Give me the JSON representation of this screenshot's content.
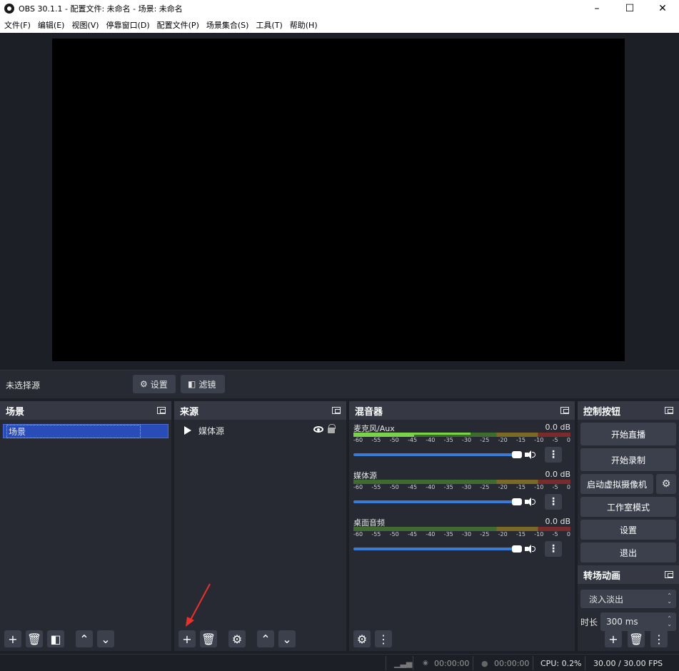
{
  "window": {
    "title": "OBS 30.1.1 - 配置文件: 未命名 - 场景: 未命名",
    "minimize": "–",
    "maximize": "☐",
    "close": "✕"
  },
  "menu": [
    "文件(F)",
    "编辑(E)",
    "视图(V)",
    "停靠窗口(D)",
    "配置文件(P)",
    "场景集合(S)",
    "工具(T)",
    "帮助(H)"
  ],
  "source_bar": {
    "label": "未选择源",
    "settings": "设置",
    "filters": "滤镜"
  },
  "scenes": {
    "title": "场景",
    "items": [
      "场景"
    ]
  },
  "sources": {
    "title": "来源",
    "items": [
      {
        "name": "媒体源"
      }
    ]
  },
  "mixer": {
    "title": "混音器",
    "scale": [
      "-60",
      "-55",
      "-50",
      "-45",
      "-40",
      "-35",
      "-30",
      "-25",
      "-20",
      "-15",
      "-10",
      "-5",
      "0"
    ],
    "channels": [
      {
        "name": "麦克风/Aux",
        "level": "0.0 dB",
        "volume": 1.0
      },
      {
        "name": "媒体源",
        "level": "0.0 dB",
        "volume": 1.0
      },
      {
        "name": "桌面音频",
        "level": "0.0 dB",
        "volume": 1.0
      }
    ]
  },
  "controls": {
    "title": "控制按钮",
    "start_stream": "开始直播",
    "start_record": "开始录制",
    "virtual_cam": "启动虚拟摄像机",
    "studio_mode": "工作室模式",
    "settings": "设置",
    "exit": "退出"
  },
  "transitions": {
    "title": "转场动画",
    "selected": "淡入淡出",
    "duration_label": "时长",
    "duration": "300 ms"
  },
  "status": {
    "stream_time": "00:00:00",
    "record_time": "00:00:00",
    "cpu": "CPU: 0.2%",
    "fps": "30.00 / 30.00 FPS"
  },
  "colors": {
    "accent": "#284cb8",
    "volume": "#3a7bd5",
    "panel": "#272a33",
    "annotation": "#e8312a"
  }
}
